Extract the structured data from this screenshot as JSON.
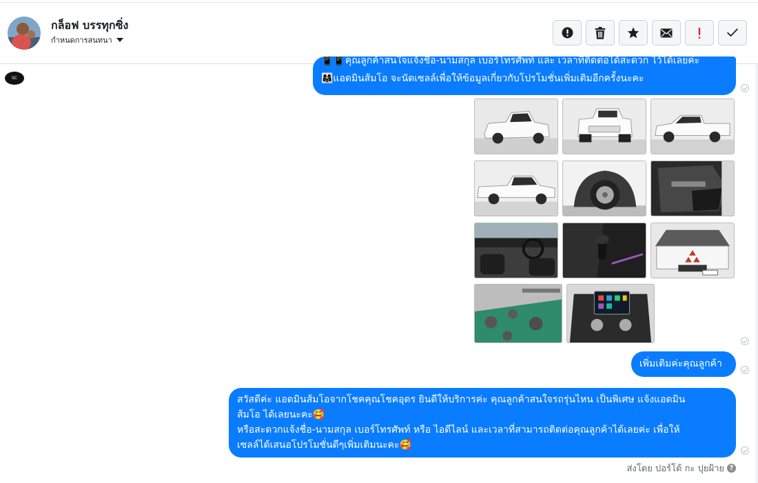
{
  "contact": {
    "name": "กล็อฟ บรรทุกซิ่ง",
    "assign_label": "กำหนดการสนทนา"
  },
  "actions": [
    {
      "name": "follow-up-button",
      "icon": "exclamation-circle-icon",
      "label": "!"
    },
    {
      "name": "delete-button",
      "icon": "trash-icon"
    },
    {
      "name": "star-button",
      "icon": "star-icon"
    },
    {
      "name": "mark-unread-button",
      "icon": "envelope-icon"
    },
    {
      "name": "spam-button",
      "icon": "red-exclamation-icon",
      "label": "!"
    },
    {
      "name": "done-button",
      "icon": "checkmark-icon"
    }
  ],
  "messages": {
    "first": {
      "line1": "📱📱คุณลูกค้าสนใจแจ้งชื่อ-นามสกุล เบอร์โทรศัพท์ และ เวลาที่ติดต่อได้สะดวก ไว้ได้เลยค่ะ",
      "line2": "👩‍👩‍👧แอดมินส้มโอ จะนัดเซลล์เพื่อให้ข้อมูลเกี่ยวกับโปรโมชั่นเพิ่มเติมอีกครั้งนะคะ"
    },
    "second": {
      "text": "เพิ่มเติมค่ะคุณลูกค้า"
    },
    "third": {
      "line1": "สวัสดีค่ะ แอดมินส้มโอจากโชคคุณโชคอุดร ยินดีให้บริการค่ะ   คุณลูกค้าสนใจรถรุ่นไหน เป็นพิเศษ แจ้งแอดมิน",
      "line2": "ส้มโอ ได้เลยนะคะ🥰",
      "line3": "หรือสะดวกแจ้งชื่อ-นามสกุล เบอร์โทรศัพท์ หรือ ไอดีไลน์ และเวลาที่สามารถติดต่อคุณลูกค้าได้เลยค่ะ เพื่อให้",
      "line4": "เซลล์ได้เสนอโปรโมชั่นดีๆเพิ่มเติมนะคะ🥰"
    }
  },
  "photos": [
    {
      "name": "photo-truck-rear-left",
      "subject": "white pickup truck rear three-quarter view"
    },
    {
      "name": "photo-truck-rear",
      "subject": "white pickup truck rear view"
    },
    {
      "name": "photo-truck-side",
      "subject": "white pickup truck side view"
    },
    {
      "name": "photo-truck-side-2",
      "subject": "white pickup truck side view"
    },
    {
      "name": "photo-wheel",
      "subject": "wheel and fender close-up"
    },
    {
      "name": "photo-door-panel",
      "subject": "door interior panel"
    },
    {
      "name": "photo-dashboard",
      "subject": "interior dashboard and seats"
    },
    {
      "name": "photo-gear-shift",
      "subject": "gear shift console"
    },
    {
      "name": "photo-engine",
      "subject": "engine bay with Mitsubishi logo"
    },
    {
      "name": "photo-parts",
      "subject": "parts on green workbench"
    },
    {
      "name": "photo-radio",
      "subject": "touchscreen head unit"
    }
  ],
  "footer": {
    "sender_text": "ส่งโดย ปอร์โต้ กะ ปุยฝ้าย",
    "help_icon": "question-circle-icon",
    "help_glyph": "?"
  },
  "page_logo_text": "SC",
  "colors": {
    "bubble": "#0a7cff",
    "danger": "#e41e3f"
  }
}
